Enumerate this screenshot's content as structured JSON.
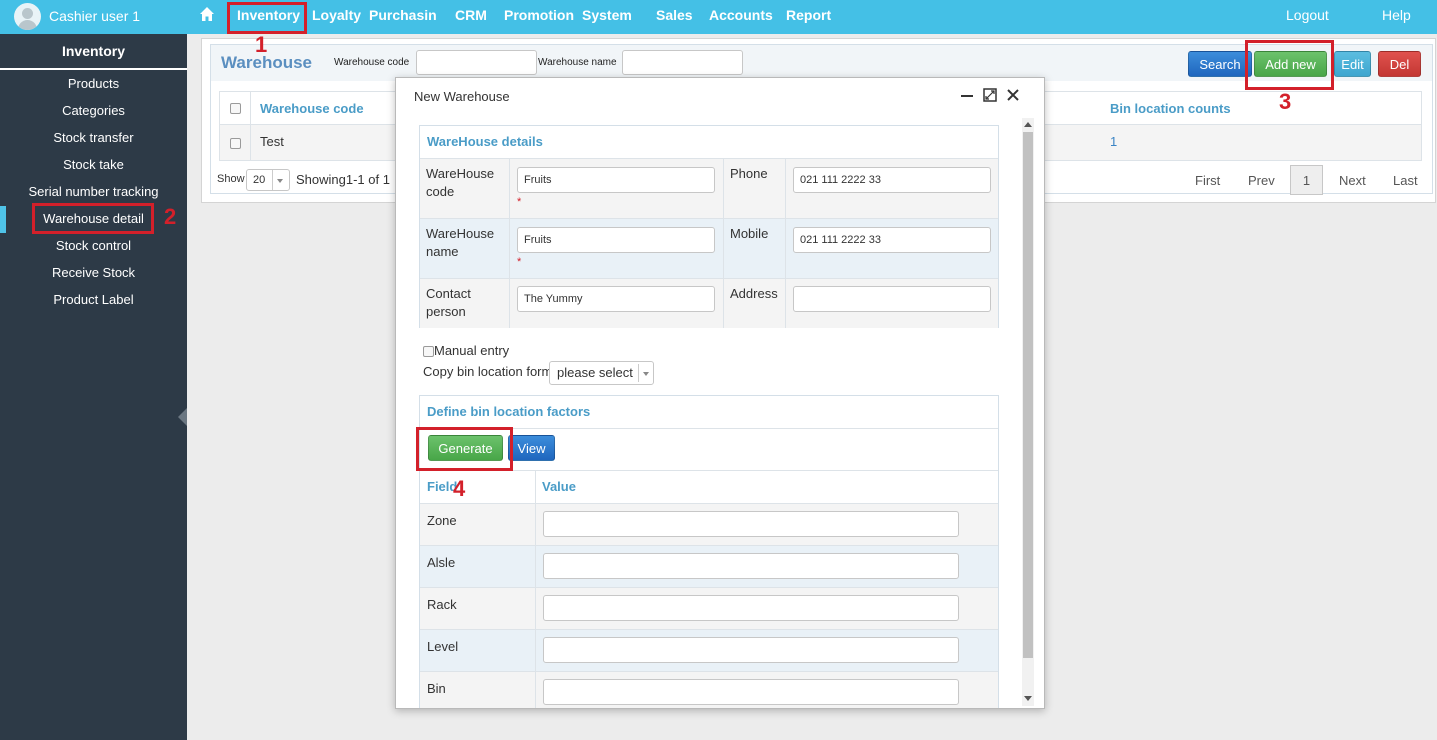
{
  "user": {
    "name": "Cashier user 1"
  },
  "nav": {
    "items": [
      "Inventory",
      "Loyalty",
      "Purchasing",
      "CRM",
      "Promotion",
      "System",
      "Sales",
      "Accounts",
      "Report"
    ],
    "logout": "Logout",
    "help": "Help"
  },
  "sidebar": {
    "title": "Inventory",
    "items": [
      "Products",
      "Categories",
      "Stock transfer",
      "Stock take",
      "Serial number tracking",
      "Warehouse detail",
      "Stock control",
      "Receive Stock",
      "Product Label"
    ],
    "active": "Warehouse detail"
  },
  "page": {
    "title": "Warehouse",
    "filter_code_label": "Warehouse code",
    "filter_name_label": "Warehouse name",
    "buttons": {
      "search": "Search",
      "add_new": "Add new",
      "edit": "Edit",
      "del": "Del"
    },
    "columns": [
      "Warehouse code",
      "Bin location counts"
    ],
    "rows": [
      {
        "code": "Test",
        "bin_count": "1"
      }
    ],
    "show_label": "Show",
    "page_size": "20",
    "showing": "Showing1-1 of 1",
    "pagination": {
      "first": "First",
      "prev": "Prev",
      "current": "1",
      "next": "Next",
      "last": "Last"
    }
  },
  "modal": {
    "title": "New Warehouse",
    "details_title": "WareHouse details",
    "fields": {
      "code_label": "WareHouse code",
      "code_value": "Fruits",
      "name_label": "WareHouse name",
      "name_value": "Fruits",
      "contact_label": "Contact person",
      "contact_value": "The Yummy",
      "phone_label": "Phone",
      "phone_value": "021 111 2222 33",
      "mobile_label": "Mobile",
      "mobile_value": "021 111 2222 33",
      "address_label": "Address",
      "address_value": "",
      "required_mark": "*"
    },
    "manual_entry": "Manual entry",
    "copy_bin_label": "Copy bin location form",
    "copy_bin_select": "please select",
    "bin_title": "Define bin location factors",
    "generate": "Generate",
    "view": "View",
    "bin_columns": [
      "Field",
      "Value"
    ],
    "bin_fields": [
      "Zone",
      "Alsle",
      "Rack",
      "Level",
      "Bin"
    ]
  },
  "markers": [
    "1",
    "2",
    "3",
    "4"
  ],
  "colors": {
    "topbar": "#44c0e6",
    "sidebar": "#2d3a47",
    "marker": "#d3202a",
    "accent_text": "#4a9cc7"
  }
}
